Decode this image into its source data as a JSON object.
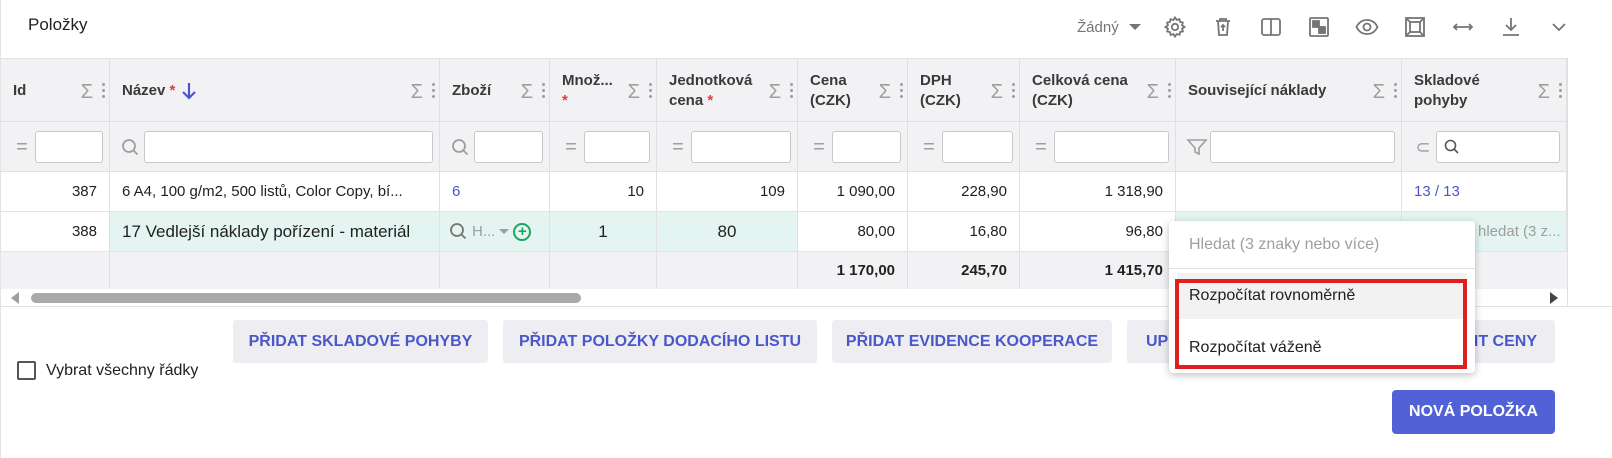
{
  "header": {
    "title": "Položky",
    "preset_label": "Žádný",
    "icons": [
      "gear-icon",
      "delete-icon",
      "columns-icon",
      "layout-icon",
      "eye-icon",
      "frame-icon",
      "expand-width-icon",
      "download-icon",
      "chevron-down-icon"
    ]
  },
  "columns": [
    {
      "label": "Id",
      "required": ""
    },
    {
      "label": "Název",
      "required": "*"
    },
    {
      "label": "Zboží",
      "required": ""
    },
    {
      "label": "Množ...",
      "required": "*"
    },
    {
      "label": "Jednotková cena",
      "required": "*"
    },
    {
      "label": "Cena (CZK)",
      "required": ""
    },
    {
      "label": "DPH (CZK)",
      "required": ""
    },
    {
      "label": "Celková cena (CZK)",
      "required": ""
    },
    {
      "label": "Související náklady",
      "required": ""
    },
    {
      "label": "Skladové pohyby",
      "required": ""
    }
  ],
  "sigma": "Σ",
  "filter_ops": {
    "eq": "=",
    "contains": "⊂"
  },
  "rows": [
    {
      "id": "387",
      "nazev": "6 A4, 100 g/m2, 500 listů, Color Copy, bí...",
      "zbozi": "6",
      "mnozstvi": "10",
      "jedn_cena": "109",
      "cena": "1 090,00",
      "dph": "228,90",
      "celkova": "1 318,90",
      "souvisejici": "",
      "sklad": "13 / 13"
    },
    {
      "id": "388",
      "nazev": "17 Vedlejší náklady pořízení - materiál",
      "zbozi": "H...",
      "mnozstvi": "1",
      "jedn_cena": "80",
      "cena": "80,00",
      "dph": "16,80",
      "celkova": "96,80",
      "souvisejici": "",
      "sklad": "hledat (3 z..."
    }
  ],
  "totals": {
    "cena": "1 170,00",
    "dph": "245,70",
    "celkova": "1 415,70"
  },
  "footer": {
    "select_all": "Vybrat všechny řádky",
    "buttons": [
      "PŘIDAT SKLADOVÉ POHYBY",
      "PŘIDAT POLOŽKY DODACÍHO LISTU",
      "PŘIDAT EVIDENCE KOOPERACE",
      "UP",
      "IT CENY"
    ],
    "new_item": "NOVÁ POLOŽKA"
  },
  "popup": {
    "search_placeholder": "Hledat (3 znaky nebo více)",
    "options": [
      "Rozpočítat rovnoměrně",
      "Rozpočítat váženě"
    ]
  },
  "colors": {
    "accent": "#5162d6",
    "link": "#4a57c9",
    "highlight_row": "#e3f4f1",
    "annotation": "#e02020"
  }
}
